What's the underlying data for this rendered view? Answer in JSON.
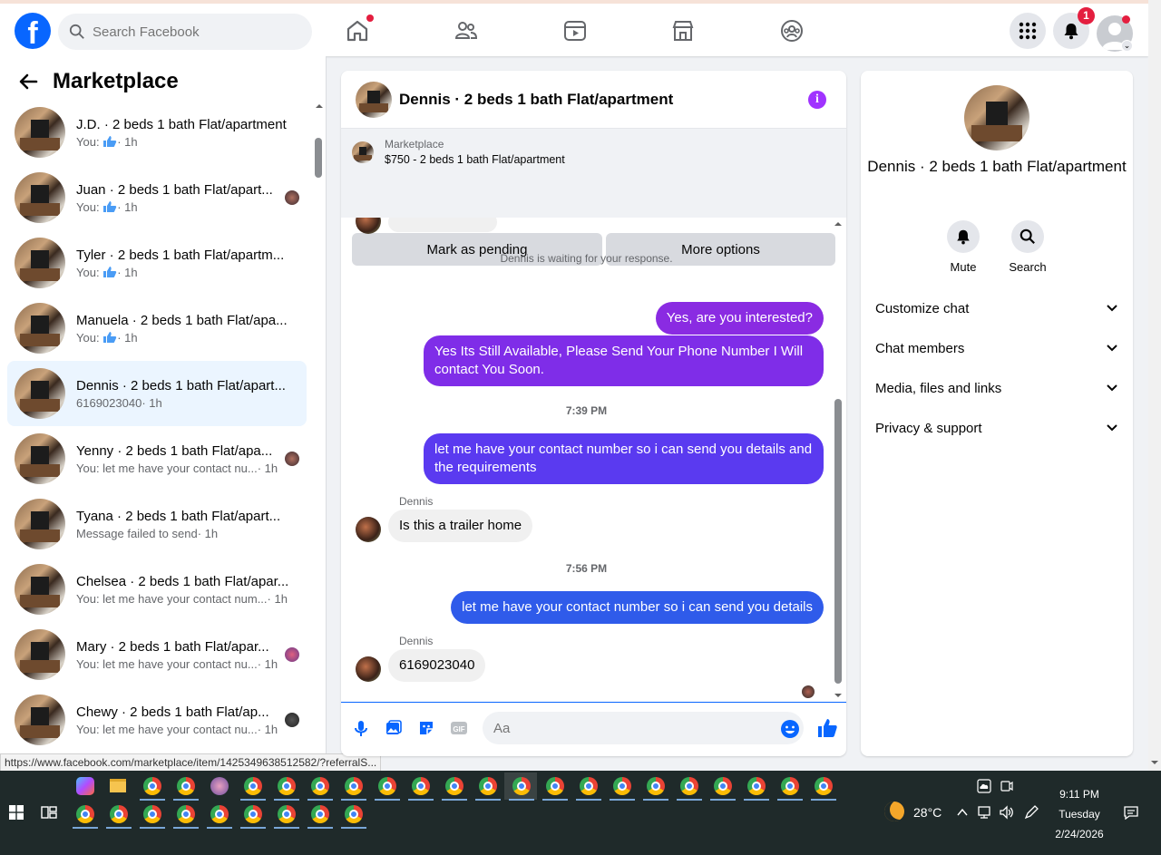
{
  "topbar": {
    "search_placeholder": "Search Facebook",
    "notification_count": "1"
  },
  "left": {
    "title": "Marketplace",
    "conversations": [
      {
        "title": "J.D. · 2 beds 1 bath Flat/apartment",
        "sub_prefix": "You:",
        "sub_suffix": "· 1h",
        "like": true
      },
      {
        "title": "Juan · 2 beds 1 bath Flat/apart...",
        "sub_prefix": "You:",
        "sub_suffix": "· 1h",
        "like": true
      },
      {
        "title": "Tyler · 2 beds 1 bath Flat/apartm...",
        "sub_prefix": "You:",
        "sub_suffix": "· 1h",
        "like": true
      },
      {
        "title": "Manuela · 2 beds 1 bath Flat/apa...",
        "sub_prefix": "You:",
        "sub_suffix": "· 1h",
        "like": true
      },
      {
        "title": "Dennis · 2 beds 1 bath Flat/apart...",
        "sub_prefix": "6169023040",
        "sub_suffix": "· 1h",
        "like": false
      },
      {
        "title": "Yenny · 2 beds 1 bath Flat/apa...",
        "sub_prefix": "You: let me have your contact nu...",
        "sub_suffix": "· 1h",
        "like": false
      },
      {
        "title": "Tyana · 2 beds 1 bath Flat/apart...",
        "sub_prefix": "Message failed to send",
        "sub_suffix": "· 1h",
        "like": false
      },
      {
        "title": "Chelsea · 2 beds 1 bath Flat/apar...",
        "sub_prefix": "You: let me have your contact num...",
        "sub_suffix": "· 1h",
        "like": false
      },
      {
        "title": "Mary · 2 beds 1 bath Flat/apar...",
        "sub_prefix": "You: let me have your contact nu...",
        "sub_suffix": "· 1h",
        "like": false
      },
      {
        "title": "Chewy · 2 beds 1 bath Flat/ap...",
        "sub_prefix": "You: let me have your contact nu...",
        "sub_suffix": "· 1h",
        "like": false
      }
    ],
    "status_url": "https://www.facebook.com/marketplace/item/1425349638512582/?referralS..."
  },
  "chat": {
    "title": "Dennis · 2 beds 1 bath Flat/apartment",
    "marketplace_label": "Marketplace",
    "listing": "$750 - 2 beds 1 bath Flat/apartment",
    "mark_pending": "Mark as pending",
    "more_options": "More options",
    "waiting_note": "Dennis is waiting for your response.",
    "msg1": "Yes, are you interested?",
    "msg2": "Yes Its Still Available, Please Send Your Phone Number I Will contact You Soon.",
    "time1": "7:39 PM",
    "msg3": "let me have your contact number so i can send you details and the requirements",
    "sender1": "Dennis",
    "msg4": "Is this a trailer home",
    "time2": "7:56 PM",
    "msg5": "let me have your contact number so i can send you details",
    "sender2": "Dennis",
    "msg6": "6169023040",
    "input_placeholder": "Aa"
  },
  "right": {
    "title": "Dennis · 2 beds 1 bath Flat/apartment",
    "mute": "Mute",
    "search": "Search",
    "rows": [
      "Customize chat",
      "Chat members",
      "Media, files and links",
      "Privacy & support"
    ]
  },
  "taskbar": {
    "temperature": "28°C",
    "time": "9:11 PM",
    "day": "Tuesday",
    "date": "2/24/2026"
  },
  "colors": {
    "brand": "#0866ff",
    "bubble_purple": "#8a2be2",
    "bubble_blue": "#2f5bea",
    "active_conv": "#ebf5ff"
  }
}
